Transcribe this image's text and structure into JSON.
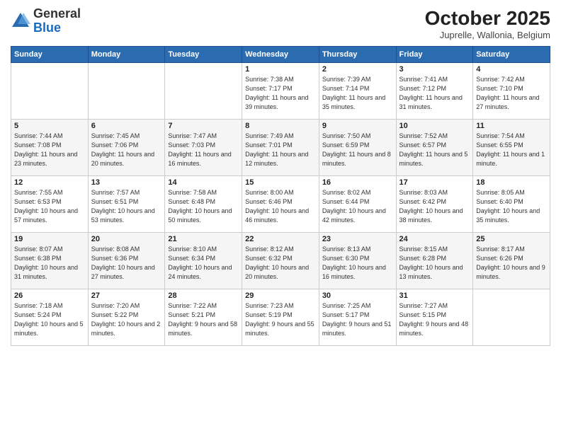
{
  "header": {
    "logo": {
      "general": "General",
      "blue": "Blue"
    },
    "title": "October 2025",
    "subtitle": "Juprelle, Wallonia, Belgium"
  },
  "weekdays": [
    "Sunday",
    "Monday",
    "Tuesday",
    "Wednesday",
    "Thursday",
    "Friday",
    "Saturday"
  ],
  "weeks": [
    [
      {
        "day": "",
        "info": ""
      },
      {
        "day": "",
        "info": ""
      },
      {
        "day": "",
        "info": ""
      },
      {
        "day": "1",
        "info": "Sunrise: 7:38 AM\nSunset: 7:17 PM\nDaylight: 11 hours\nand 39 minutes."
      },
      {
        "day": "2",
        "info": "Sunrise: 7:39 AM\nSunset: 7:14 PM\nDaylight: 11 hours\nand 35 minutes."
      },
      {
        "day": "3",
        "info": "Sunrise: 7:41 AM\nSunset: 7:12 PM\nDaylight: 11 hours\nand 31 minutes."
      },
      {
        "day": "4",
        "info": "Sunrise: 7:42 AM\nSunset: 7:10 PM\nDaylight: 11 hours\nand 27 minutes."
      }
    ],
    [
      {
        "day": "5",
        "info": "Sunrise: 7:44 AM\nSunset: 7:08 PM\nDaylight: 11 hours\nand 23 minutes."
      },
      {
        "day": "6",
        "info": "Sunrise: 7:45 AM\nSunset: 7:06 PM\nDaylight: 11 hours\nand 20 minutes."
      },
      {
        "day": "7",
        "info": "Sunrise: 7:47 AM\nSunset: 7:03 PM\nDaylight: 11 hours\nand 16 minutes."
      },
      {
        "day": "8",
        "info": "Sunrise: 7:49 AM\nSunset: 7:01 PM\nDaylight: 11 hours\nand 12 minutes."
      },
      {
        "day": "9",
        "info": "Sunrise: 7:50 AM\nSunset: 6:59 PM\nDaylight: 11 hours\nand 8 minutes."
      },
      {
        "day": "10",
        "info": "Sunrise: 7:52 AM\nSunset: 6:57 PM\nDaylight: 11 hours\nand 5 minutes."
      },
      {
        "day": "11",
        "info": "Sunrise: 7:54 AM\nSunset: 6:55 PM\nDaylight: 11 hours\nand 1 minute."
      }
    ],
    [
      {
        "day": "12",
        "info": "Sunrise: 7:55 AM\nSunset: 6:53 PM\nDaylight: 10 hours\nand 57 minutes."
      },
      {
        "day": "13",
        "info": "Sunrise: 7:57 AM\nSunset: 6:51 PM\nDaylight: 10 hours\nand 53 minutes."
      },
      {
        "day": "14",
        "info": "Sunrise: 7:58 AM\nSunset: 6:48 PM\nDaylight: 10 hours\nand 50 minutes."
      },
      {
        "day": "15",
        "info": "Sunrise: 8:00 AM\nSunset: 6:46 PM\nDaylight: 10 hours\nand 46 minutes."
      },
      {
        "day": "16",
        "info": "Sunrise: 8:02 AM\nSunset: 6:44 PM\nDaylight: 10 hours\nand 42 minutes."
      },
      {
        "day": "17",
        "info": "Sunrise: 8:03 AM\nSunset: 6:42 PM\nDaylight: 10 hours\nand 38 minutes."
      },
      {
        "day": "18",
        "info": "Sunrise: 8:05 AM\nSunset: 6:40 PM\nDaylight: 10 hours\nand 35 minutes."
      }
    ],
    [
      {
        "day": "19",
        "info": "Sunrise: 8:07 AM\nSunset: 6:38 PM\nDaylight: 10 hours\nand 31 minutes."
      },
      {
        "day": "20",
        "info": "Sunrise: 8:08 AM\nSunset: 6:36 PM\nDaylight: 10 hours\nand 27 minutes."
      },
      {
        "day": "21",
        "info": "Sunrise: 8:10 AM\nSunset: 6:34 PM\nDaylight: 10 hours\nand 24 minutes."
      },
      {
        "day": "22",
        "info": "Sunrise: 8:12 AM\nSunset: 6:32 PM\nDaylight: 10 hours\nand 20 minutes."
      },
      {
        "day": "23",
        "info": "Sunrise: 8:13 AM\nSunset: 6:30 PM\nDaylight: 10 hours\nand 16 minutes."
      },
      {
        "day": "24",
        "info": "Sunrise: 8:15 AM\nSunset: 6:28 PM\nDaylight: 10 hours\nand 13 minutes."
      },
      {
        "day": "25",
        "info": "Sunrise: 8:17 AM\nSunset: 6:26 PM\nDaylight: 10 hours\nand 9 minutes."
      }
    ],
    [
      {
        "day": "26",
        "info": "Sunrise: 7:18 AM\nSunset: 5:24 PM\nDaylight: 10 hours\nand 5 minutes."
      },
      {
        "day": "27",
        "info": "Sunrise: 7:20 AM\nSunset: 5:22 PM\nDaylight: 10 hours\nand 2 minutes."
      },
      {
        "day": "28",
        "info": "Sunrise: 7:22 AM\nSunset: 5:21 PM\nDaylight: 9 hours\nand 58 minutes."
      },
      {
        "day": "29",
        "info": "Sunrise: 7:23 AM\nSunset: 5:19 PM\nDaylight: 9 hours\nand 55 minutes."
      },
      {
        "day": "30",
        "info": "Sunrise: 7:25 AM\nSunset: 5:17 PM\nDaylight: 9 hours\nand 51 minutes."
      },
      {
        "day": "31",
        "info": "Sunrise: 7:27 AM\nSunset: 5:15 PM\nDaylight: 9 hours\nand 48 minutes."
      },
      {
        "day": "",
        "info": ""
      }
    ]
  ]
}
